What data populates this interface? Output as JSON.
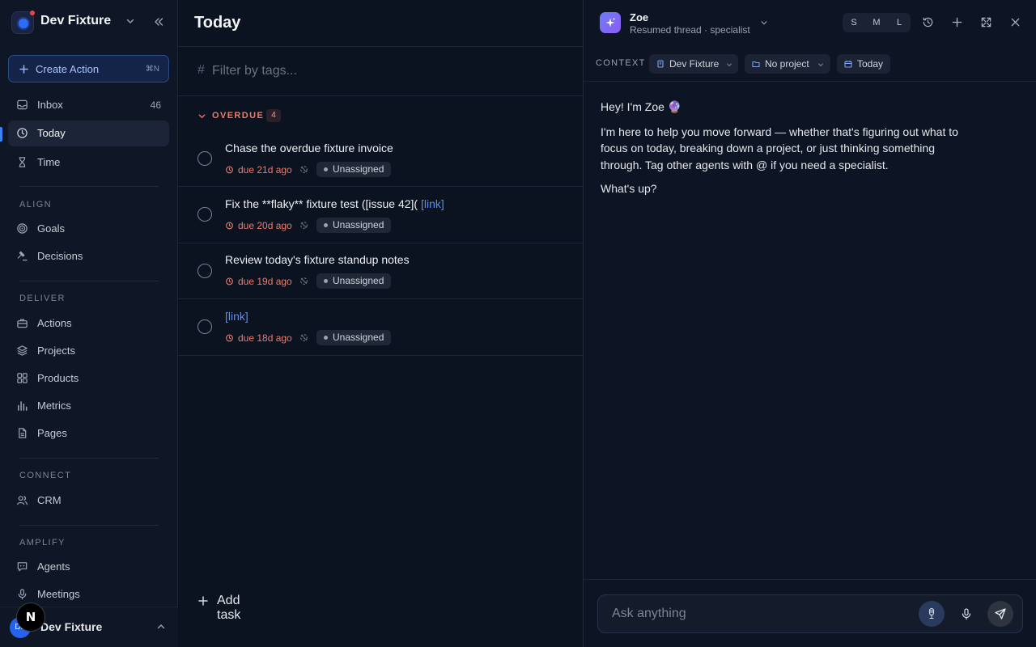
{
  "workspace": {
    "name": "Dev Fixture"
  },
  "create_action": {
    "label": "Create Action",
    "shortcut": "⌘N"
  },
  "nav": {
    "inbox": {
      "label": "Inbox",
      "count": "46"
    },
    "today": {
      "label": "Today"
    },
    "time": {
      "label": "Time"
    },
    "sections": {
      "align": "ALIGN",
      "deliver": "DELIVER",
      "connect": "CONNECT",
      "amplify": "AMPLIFY"
    },
    "goals": "Goals",
    "decisions": "Decisions",
    "actions": "Actions",
    "projects": "Projects",
    "products": "Products",
    "metrics": "Metrics",
    "pages": "Pages",
    "crm": "CRM",
    "agents": "Agents",
    "meetings": "Meetings"
  },
  "user": {
    "initials": "DF",
    "name": "Dev Fixture"
  },
  "overlay_badge": "N",
  "main": {
    "title": "Today",
    "filter_placeholder": "Filter by tags...",
    "group": {
      "name": "OVERDUE",
      "count": "4"
    },
    "tasks": [
      {
        "title": "Chase the overdue fixture invoice",
        "link": "",
        "due": "due 21d ago",
        "assignee": "Unassigned"
      },
      {
        "title": "Fix the **flaky** fixture test ([issue 42](",
        "link": "[link]",
        "due": "due 20d ago",
        "assignee": "Unassigned"
      },
      {
        "title": "Review today's fixture standup notes",
        "link": "",
        "due": "due 19d ago",
        "assignee": "Unassigned"
      },
      {
        "title": "",
        "link": "[link]",
        "due": "due 18d ago",
        "assignee": "Unassigned"
      }
    ],
    "add_task": "Add task"
  },
  "chat": {
    "agent_name": "Zoe",
    "agent_sub": "Resumed thread · specialist",
    "sizes": [
      "S",
      "M",
      "L"
    ],
    "context_label": "CONTEXT",
    "context": {
      "workspace": "Dev Fixture",
      "project": "No project",
      "date": "Today"
    },
    "messages": [
      "Hey! I'm Zoe 🔮",
      "I'm here to help you move forward — whether that's figuring out what to focus on today, breaking down a project, or just thinking something through. Tag other agents with @ if you need a specialist.",
      "What's up?"
    ],
    "input_placeholder": "Ask anything"
  },
  "colors": {
    "accent": "#3b82f6",
    "overdue": "#f07a6a",
    "link": "#5b8def",
    "background": "#0b1220"
  }
}
